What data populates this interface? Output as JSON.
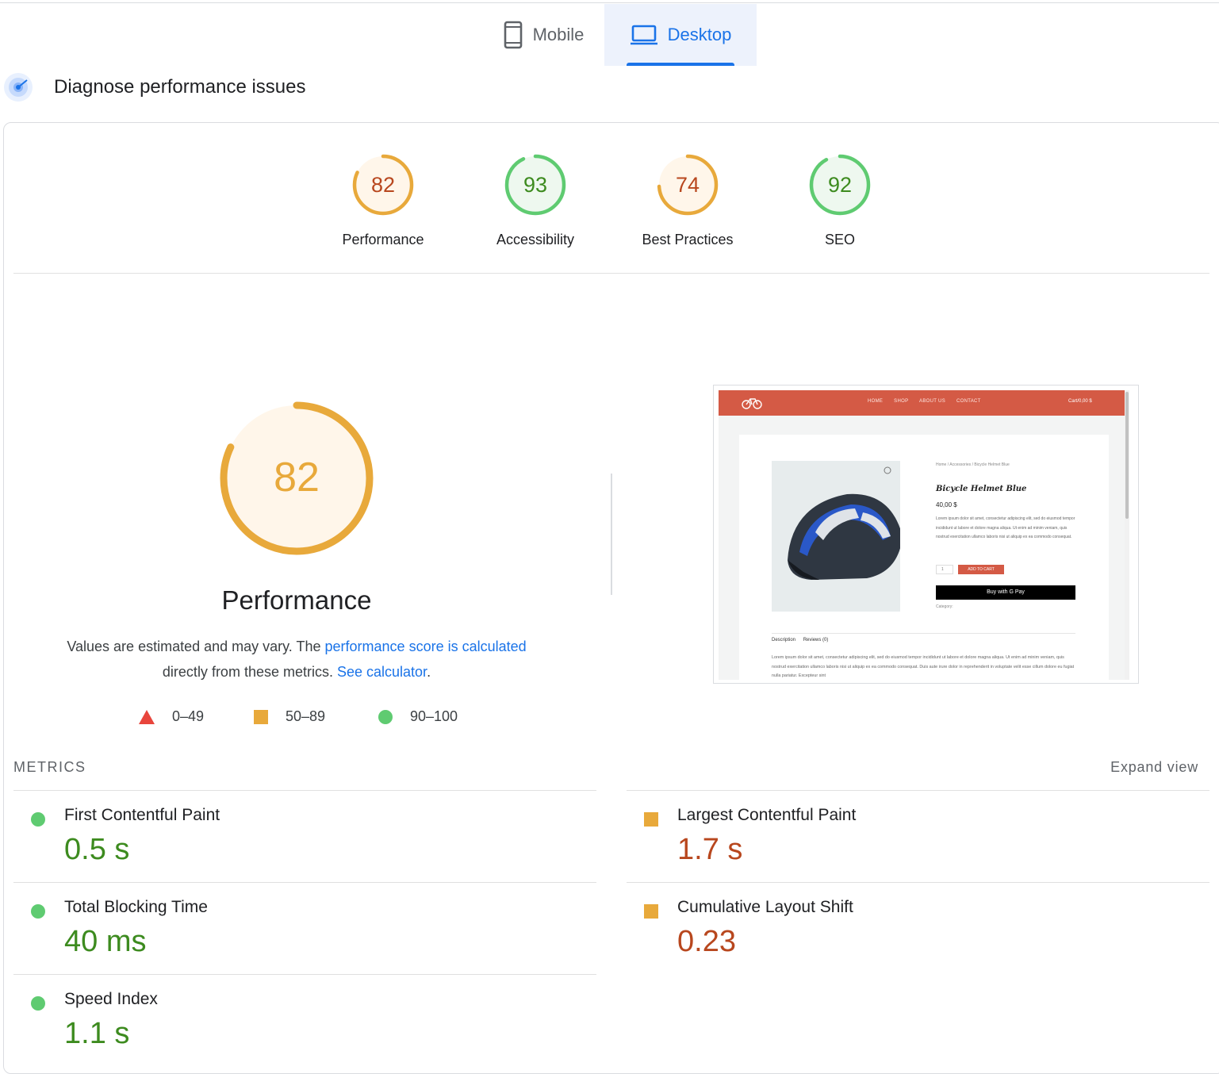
{
  "tabs": {
    "mobile": {
      "label": "Mobile",
      "icon": "phone-icon"
    },
    "desktop": {
      "label": "Desktop",
      "icon": "laptop-icon",
      "selected": true
    }
  },
  "diagnose": {
    "title": "Diagnose performance issues",
    "icon": "radar-icon"
  },
  "scores": [
    {
      "label": "Performance",
      "score": "82",
      "rating": "average"
    },
    {
      "label": "Accessibility",
      "score": "93",
      "rating": "pass"
    },
    {
      "label": "Best Practices",
      "score": "74",
      "rating": "average"
    },
    {
      "label": "SEO",
      "score": "92",
      "rating": "pass"
    }
  ],
  "colors": {
    "pass": "#0cce6b",
    "pass_text": "#3d8b1f",
    "pass_fill": "#eef8ef",
    "average": "#e8a93b",
    "average_text": "#b8471e",
    "average_fill": "#fff6ea",
    "fail": "#e8453c",
    "accent": "#1a73e8"
  },
  "performance": {
    "score": "82",
    "title": "Performance",
    "desc_prefix": "Values are estimated and may vary. The ",
    "desc_link1": "performance score is calculated",
    "desc_middle": "directly from these metrics. ",
    "desc_link2": "See calculator",
    "desc_suffix": "."
  },
  "legend": [
    {
      "range": "0–49",
      "shape": "triangle-icon"
    },
    {
      "range": "50–89",
      "shape": "square-icon"
    },
    {
      "range": "90–100",
      "shape": "circle-icon"
    }
  ],
  "screenshot": {
    "nav": [
      "HOME",
      "SHOP",
      "ABOUT US",
      "CONTACT"
    ],
    "cart": "Cart/0,00 $",
    "breadcrumb": "Home / Accessories / Bicycle Helmet Blue",
    "product_name": "Bicycle Helmet Blue",
    "price": "40,00 $",
    "description": "Lorem ipsum dolor sit amet, consectetur adipiscing elit, sed do eiusmod tempor incididunt ut labore et dolore magna aliqua. Ut enim ad minim veniam, quis nostrud exercitation ullamco laboris nisi ut aliquip ex ea commodo consequat.",
    "qty": "1",
    "add_to_cart": "ADD TO CART",
    "gpay": "Buy with G Pay",
    "category": "Category:",
    "tab_description": "Description",
    "tab_reviews": "Reviews (0)",
    "long_text": "Lorem ipsum dolor sit amet, consectetur adipiscing elit, sed do eiusmod tempor incididunt ut labore et dolore magna aliqua. Ut enim ad minim veniam, quis nostrud exercitation ullamco laboris nisi ut aliquip ex ea commodo consequat. Duis aute irure dolor in reprehenderit in voluptate velit esse cillum dolore eu fugiat nulla pariatur. Excepteur sint"
  },
  "metrics": {
    "label": "METRICS",
    "expand": "Expand view",
    "items": [
      {
        "name": "First Contentful Paint",
        "value": "0.5 s",
        "rating": "pass"
      },
      {
        "name": "Largest Contentful Paint",
        "value": "1.7 s",
        "rating": "average"
      },
      {
        "name": "Total Blocking Time",
        "value": "40 ms",
        "rating": "pass"
      },
      {
        "name": "Cumulative Layout Shift",
        "value": "0.23",
        "rating": "average"
      },
      {
        "name": "Speed Index",
        "value": "1.1 s",
        "rating": "pass"
      }
    ]
  }
}
